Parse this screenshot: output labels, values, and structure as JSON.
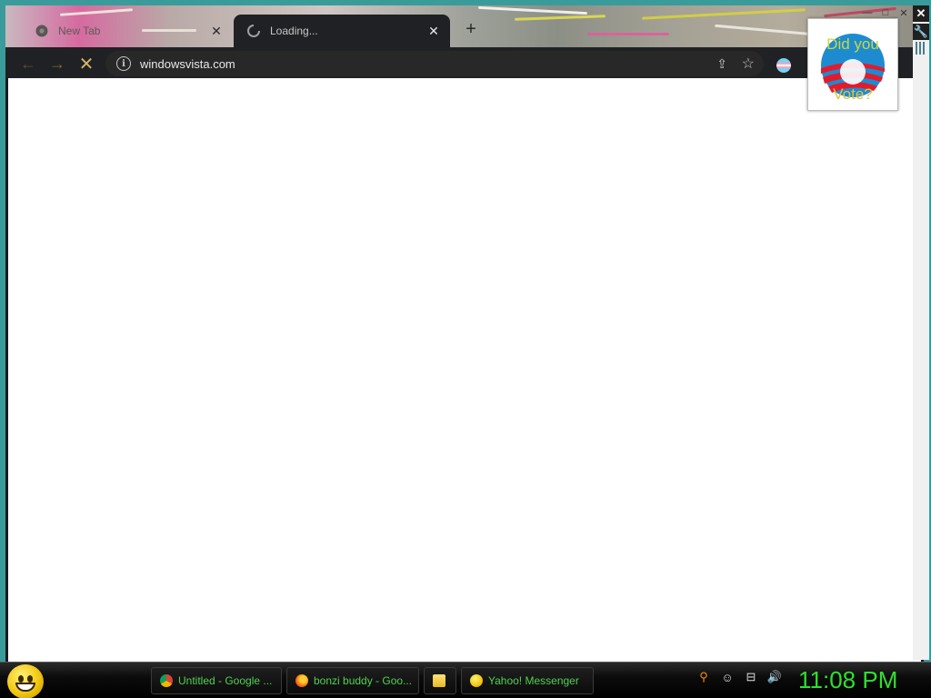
{
  "browser": {
    "tabs": [
      {
        "label": "New Tab",
        "icon": "chrome-icon",
        "active": false
      },
      {
        "label": "Loading...",
        "icon": "spinner-icon",
        "active": true
      }
    ],
    "new_tab_label": "+",
    "address_bar": {
      "url": "windowsvista.com"
    },
    "nav": {
      "back": "←",
      "forward": "→",
      "stop": "✕"
    }
  },
  "gadget": {
    "line1": "Did you",
    "line2": "Vote?"
  },
  "taskbar": {
    "tasks": [
      {
        "label": "Untitled - Google ...",
        "icon": "chrome-icon"
      },
      {
        "label": "bonzi buddy - Goo...",
        "icon": "firefox-icon"
      },
      {
        "label": "",
        "icon": "folder-icon"
      },
      {
        "label": "Yahoo! Messenger",
        "icon": "yahoo-messenger-icon"
      }
    ],
    "clock": "11:08 PM"
  },
  "colors": {
    "taskbar_text": "#4fd14f",
    "clock": "#2ee02e",
    "toolbar": "#202124"
  }
}
